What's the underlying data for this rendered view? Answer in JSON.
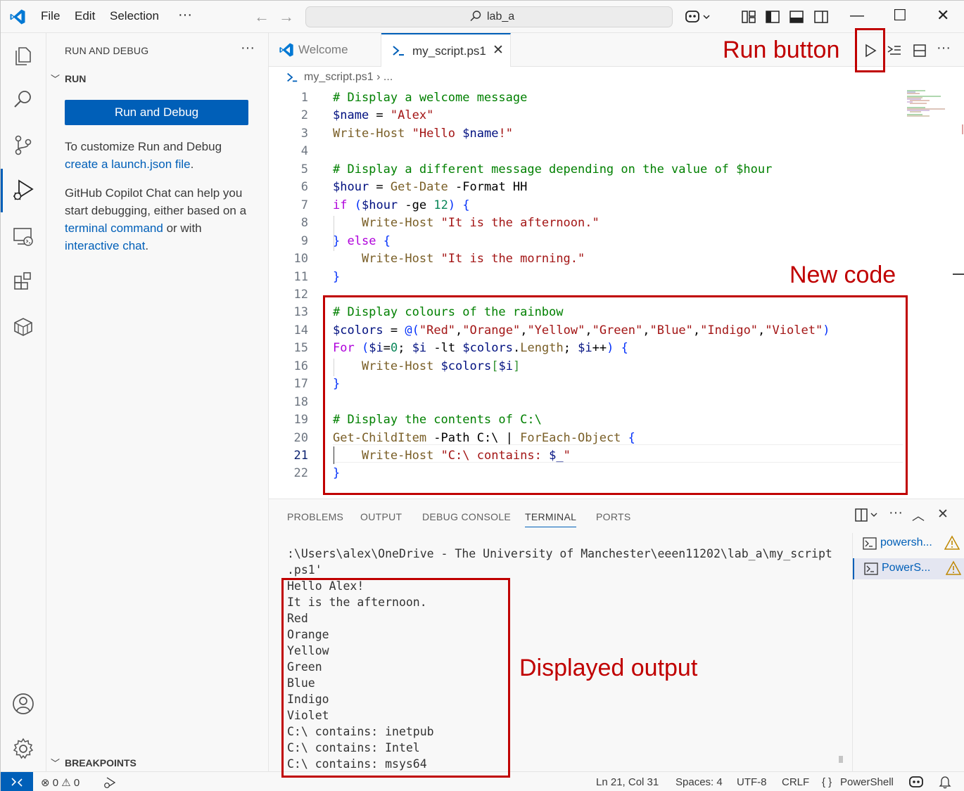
{
  "titlebar": {
    "menus": [
      "File",
      "Edit",
      "Selection"
    ],
    "more": "···",
    "search_text": "lab_a"
  },
  "sidebar": {
    "title": "RUN AND DEBUG",
    "more": "···",
    "section_run": "RUN",
    "run_button": "Run and Debug",
    "customize_text": "To customize Run and Debug",
    "launch_link": "create a launch.json file",
    "launch_suffix": ".",
    "copilot_text_1": "GitHub Copilot Chat can help you start debugging, either based on a",
    "terminal_link": "terminal command",
    "copilot_text_2": "or with",
    "chat_link": "interactive chat",
    "copilot_suffix": ".",
    "section_breakpoints": "BREAKPOINTS"
  },
  "tabs": {
    "welcome": "Welcome",
    "script": "my_script.ps1",
    "close": "✕"
  },
  "breadcrumb": {
    "file": "my_script.ps1",
    "rest": "› ..."
  },
  "editor": {
    "line_numbers": [
      "1",
      "2",
      "3",
      "4",
      "5",
      "6",
      "7",
      "8",
      "9",
      "10",
      "11",
      "12",
      "13",
      "14",
      "15",
      "16",
      "17",
      "18",
      "19",
      "20",
      "21",
      "22"
    ],
    "lines": [
      [
        {
          "t": "# Display a welcome message",
          "c": "c-com"
        }
      ],
      [
        {
          "t": "$name",
          "c": "c-var"
        },
        {
          "t": " = ",
          "c": "c-op"
        },
        {
          "t": "\"Alex\"",
          "c": "c-str"
        }
      ],
      [
        {
          "t": "Write-Host",
          "c": "c-cmd"
        },
        {
          "t": " ",
          "c": "c-op"
        },
        {
          "t": "\"Hello ",
          "c": "c-str"
        },
        {
          "t": "$name",
          "c": "c-var"
        },
        {
          "t": "!\"",
          "c": "c-str"
        }
      ],
      [],
      [
        {
          "t": "# Display a different message depending on the value of $hour",
          "c": "c-com"
        }
      ],
      [
        {
          "t": "$hour",
          "c": "c-var"
        },
        {
          "t": " = ",
          "c": "c-op"
        },
        {
          "t": "Get-Date",
          "c": "c-cmd"
        },
        {
          "t": " -Format HH",
          "c": "c-plain"
        }
      ],
      [
        {
          "t": "if",
          "c": "c-kw"
        },
        {
          "t": " ",
          "c": "c-op"
        },
        {
          "t": "(",
          "c": "c-br"
        },
        {
          "t": "$hour",
          "c": "c-var"
        },
        {
          "t": " -ge ",
          "c": "c-plain"
        },
        {
          "t": "12",
          "c": "c-num"
        },
        {
          "t": ")",
          "c": "c-br"
        },
        {
          "t": " ",
          "c": "c-op"
        },
        {
          "t": "{",
          "c": "c-br"
        }
      ],
      [
        {
          "t": "    ",
          "c": "c-op"
        },
        {
          "t": "Write-Host",
          "c": "c-cmd"
        },
        {
          "t": " ",
          "c": "c-op"
        },
        {
          "t": "\"It is the afternoon.\"",
          "c": "c-str"
        }
      ],
      [
        {
          "t": "}",
          "c": "c-br"
        },
        {
          "t": " ",
          "c": "c-op"
        },
        {
          "t": "else",
          "c": "c-kw"
        },
        {
          "t": " ",
          "c": "c-op"
        },
        {
          "t": "{",
          "c": "c-br"
        }
      ],
      [
        {
          "t": "    ",
          "c": "c-op"
        },
        {
          "t": "Write-Host",
          "c": "c-cmd"
        },
        {
          "t": " ",
          "c": "c-op"
        },
        {
          "t": "\"It is the morning.\"",
          "c": "c-str"
        }
      ],
      [
        {
          "t": "}",
          "c": "c-br"
        }
      ],
      [],
      [
        {
          "t": "# Display colours of the rainbow",
          "c": "c-com"
        }
      ],
      [
        {
          "t": "$colors",
          "c": "c-var"
        },
        {
          "t": " = ",
          "c": "c-op"
        },
        {
          "t": "@(",
          "c": "c-br"
        },
        {
          "t": "\"Red\"",
          "c": "c-str"
        },
        {
          "t": ",",
          "c": "c-op"
        },
        {
          "t": "\"Orange\"",
          "c": "c-str"
        },
        {
          "t": ",",
          "c": "c-op"
        },
        {
          "t": "\"Yellow\"",
          "c": "c-str"
        },
        {
          "t": ",",
          "c": "c-op"
        },
        {
          "t": "\"Green\"",
          "c": "c-str"
        },
        {
          "t": ",",
          "c": "c-op"
        },
        {
          "t": "\"Blue\"",
          "c": "c-str"
        },
        {
          "t": ",",
          "c": "c-op"
        },
        {
          "t": "\"Indigo\"",
          "c": "c-str"
        },
        {
          "t": ",",
          "c": "c-op"
        },
        {
          "t": "\"Violet\"",
          "c": "c-str"
        },
        {
          "t": ")",
          "c": "c-br"
        }
      ],
      [
        {
          "t": "For",
          "c": "c-kw"
        },
        {
          "t": " ",
          "c": "c-op"
        },
        {
          "t": "(",
          "c": "c-br"
        },
        {
          "t": "$i",
          "c": "c-var"
        },
        {
          "t": "=",
          "c": "c-op"
        },
        {
          "t": "0",
          "c": "c-num"
        },
        {
          "t": "; ",
          "c": "c-op"
        },
        {
          "t": "$i",
          "c": "c-var"
        },
        {
          "t": " -lt ",
          "c": "c-plain"
        },
        {
          "t": "$colors",
          "c": "c-var"
        },
        {
          "t": ".",
          "c": "c-op"
        },
        {
          "t": "Length",
          "c": "c-cmd"
        },
        {
          "t": "; ",
          "c": "c-op"
        },
        {
          "t": "$i",
          "c": "c-var"
        },
        {
          "t": "++",
          "c": "c-op"
        },
        {
          "t": ")",
          "c": "c-br"
        },
        {
          "t": " ",
          "c": "c-op"
        },
        {
          "t": "{",
          "c": "c-br"
        }
      ],
      [
        {
          "t": "    ",
          "c": "c-op"
        },
        {
          "t": "Write-Host",
          "c": "c-cmd"
        },
        {
          "t": " ",
          "c": "c-op"
        },
        {
          "t": "$colors",
          "c": "c-var"
        },
        {
          "t": "[",
          "c": "c-br2"
        },
        {
          "t": "$i",
          "c": "c-var"
        },
        {
          "t": "]",
          "c": "c-br2"
        }
      ],
      [
        {
          "t": "}",
          "c": "c-br"
        }
      ],
      [],
      [
        {
          "t": "# Display the contents of C:\\",
          "c": "c-com"
        }
      ],
      [
        {
          "t": "Get-ChildItem",
          "c": "c-cmd"
        },
        {
          "t": " -Path C:\\ | ",
          "c": "c-plain"
        },
        {
          "t": "ForEach-Object",
          "c": "c-cmd"
        },
        {
          "t": " ",
          "c": "c-op"
        },
        {
          "t": "{",
          "c": "c-br"
        }
      ],
      [
        {
          "t": "    ",
          "c": "c-op"
        },
        {
          "t": "Write-Host",
          "c": "c-cmd"
        },
        {
          "t": " ",
          "c": "c-op"
        },
        {
          "t": "\"C:\\ contains: ",
          "c": "c-str"
        },
        {
          "t": "$_",
          "c": "c-var"
        },
        {
          "t": "\"",
          "c": "c-str"
        }
      ],
      [
        {
          "t": "}",
          "c": "c-br"
        }
      ]
    ]
  },
  "annotations": {
    "run_button": "Run button",
    "new_code": "New code",
    "displayed_output": "Displayed output"
  },
  "panel": {
    "tabs": [
      "PROBLEMS",
      "OUTPUT",
      "DEBUG CONSOLE",
      "TERMINAL",
      "PORTS"
    ],
    "active_tab": "TERMINAL",
    "terminal_lines": [
      ":\\Users\\alex\\OneDrive - The University of Manchester\\eeen11202\\lab_a\\my_script",
      ".ps1'",
      "Hello Alex!",
      "It is the afternoon.",
      "Red",
      "Orange",
      "Yellow",
      "Green",
      "Blue",
      "Indigo",
      "Violet",
      "C:\\ contains: inetpub",
      "C:\\ contains: Intel",
      "C:\\ contains: msys64"
    ],
    "terminals": [
      {
        "label": "powersh..."
      },
      {
        "label": "PowerS..."
      }
    ]
  },
  "statusbar": {
    "errors": "0",
    "warnings": "0",
    "position": "Ln 21, Col 31",
    "spaces": "Spaces: 4",
    "encoding": "UTF-8",
    "eol": "CRLF",
    "language_icon": "{ }",
    "language": "PowerShell"
  },
  "colors": {
    "accent": "#005fb8",
    "annotation": "#c00000"
  }
}
